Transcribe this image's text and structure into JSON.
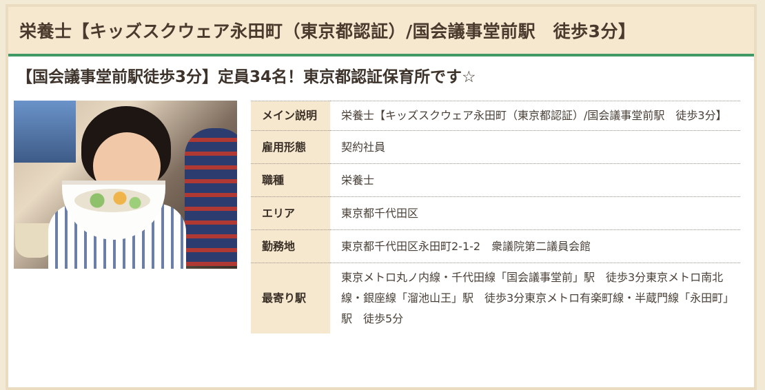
{
  "header": {
    "title": "栄養士【キッズスクウェア永田町（東京都認証）/国会議事堂前駅　徒歩3分】"
  },
  "subtitle": "【国会議事堂前駅徒歩3分】定員34名！東京都認証保育所です☆",
  "photo": {
    "alt": ""
  },
  "details": [
    {
      "label": "メイン説明",
      "value": "栄養士【キッズスクウェア永田町（東京都認証）/国会議事堂前駅　徒歩3分】"
    },
    {
      "label": "雇用形態",
      "value": "契約社員"
    },
    {
      "label": "職種",
      "value": "栄養士"
    },
    {
      "label": "エリア",
      "value": "東京都千代田区"
    },
    {
      "label": "勤務地",
      "value": "東京都千代田区永田町2-1-2　衆議院第二議員会館"
    },
    {
      "label": "最寄り駅",
      "value": "東京メトロ丸ノ内線・千代田線「国会議事堂前」駅　徒歩3分東京メトロ南北線・銀座線「溜池山王」駅　徒歩3分東京メトロ有楽町線・半蔵門線「永田町」駅　徒歩5分"
    }
  ],
  "colors": {
    "header_bg": "#f5e8cf",
    "accent_green": "#3f9a66",
    "label_bg": "#f5e8cf"
  }
}
